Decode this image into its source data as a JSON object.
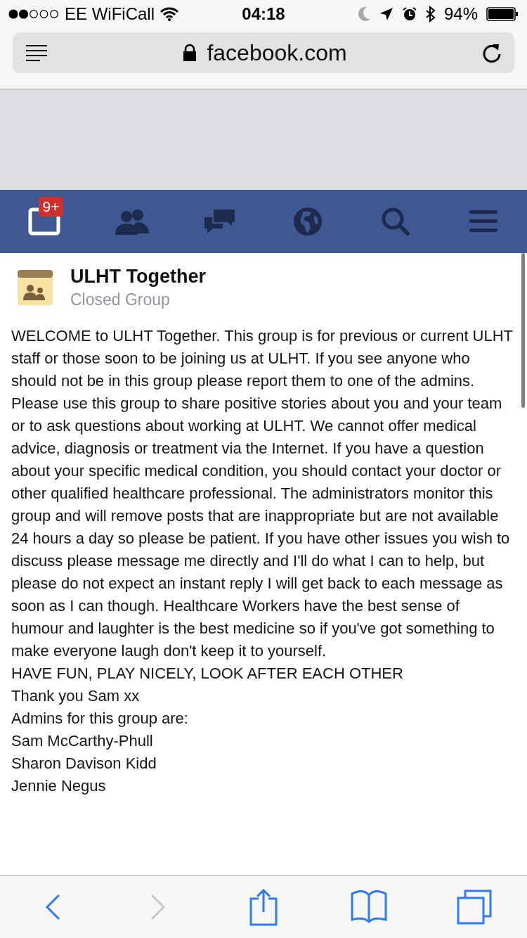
{
  "status_bar": {
    "carrier": "EE WiFiCall",
    "time": "04:18",
    "battery": "94%"
  },
  "address_bar": {
    "url": "facebook.com"
  },
  "nav_tabs": [
    {
      "kind": "notifications",
      "selected": true,
      "badge": "9+"
    },
    {
      "kind": "friends",
      "selected": false
    },
    {
      "kind": "messages",
      "selected": false
    },
    {
      "kind": "globe",
      "selected": false
    },
    {
      "kind": "search",
      "selected": false
    },
    {
      "kind": "menu",
      "selected": false
    }
  ],
  "group": {
    "name": "ULHT Together",
    "privacy": "Closed Group"
  },
  "description": [
    "WELCOME to ULHT Together. This group is for previous or current ULHT staff or those soon to be joining us at ULHT. If you see anyone who should not be in this group please report them to one of the admins. Please use this group to share positive stories about you and your team or to ask questions about working at ULHT. We cannot offer medical advice, diagnosis or treatment via the Internet. If you have a question about your specific medical condition, you should contact your doctor or other qualified healthcare professional. The administrators monitor this group and will remove posts that are inappropriate but are not available 24 hours a day so please be patient. If you have other issues you wish to discuss please message me directly and I'll do what I can to help, but please do not expect an instant reply I will get back to each message as soon as I can though. Healthcare Workers have the best sense of humour and laughter is the best medicine so if you've got something to make everyone laugh don't keep it to yourself.",
    "HAVE FUN, PLAY NICELY, LOOK AFTER EACH OTHER",
    "Thank you Sam xx",
    "Admins for this group are:",
    "Sam McCarthy-Phull",
    "Sharon Davison Kidd",
    "Jennie Negus"
  ],
  "toolbar": [
    {
      "kind": "back",
      "disabled": false
    },
    {
      "kind": "forward",
      "disabled": true
    },
    {
      "kind": "share",
      "disabled": false
    },
    {
      "kind": "bookmarks",
      "disabled": false
    },
    {
      "kind": "tabs",
      "disabled": false
    }
  ]
}
